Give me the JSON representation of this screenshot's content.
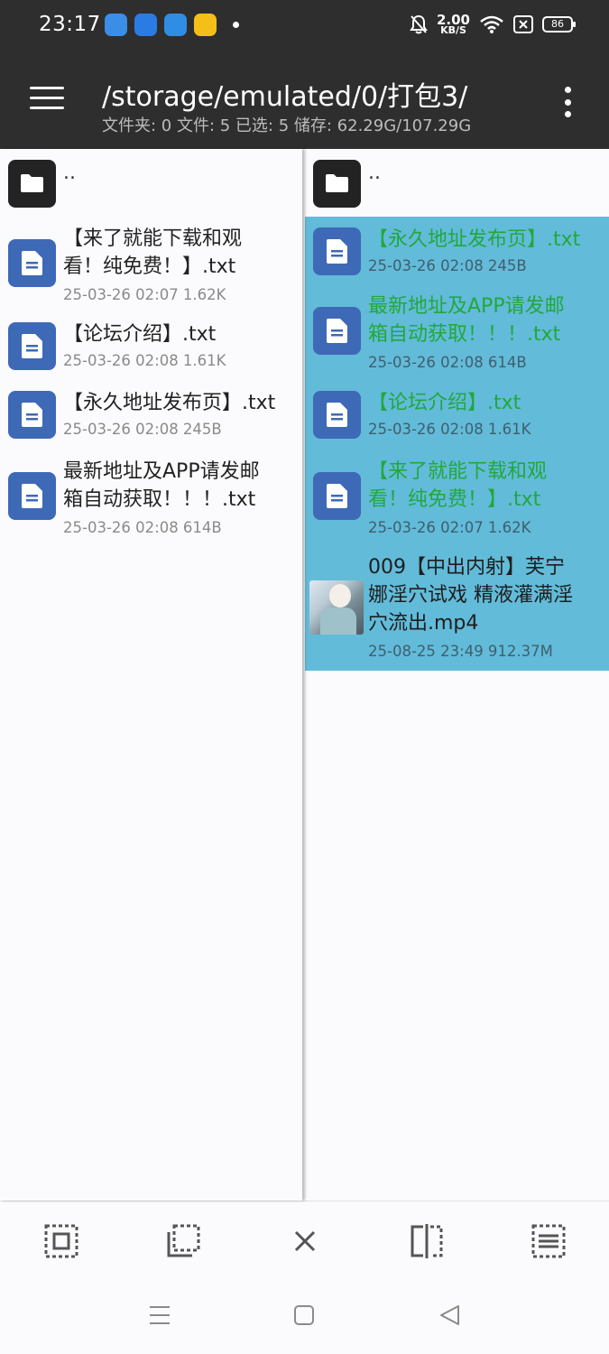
{
  "status_bar": {
    "time": "23:17",
    "net_speed_value": "2.00",
    "net_speed_unit": "KB/S",
    "battery": "86",
    "notification_icons": [
      "weather-icon",
      "messages-icon",
      "browser-icon",
      "shopping-app-icon"
    ],
    "system_icons": [
      "mute-icon",
      "wifi-icon",
      "sim-off-icon",
      "battery-icon"
    ]
  },
  "header": {
    "path": "/storage/emulated/0/打包3/",
    "info": "文件夹: 0  文件: 5  已选: 5  储存: 62.29G/107.29G"
  },
  "left_pane": {
    "parent_label": "..",
    "files": [
      {
        "name": "【来了就能下载和观看！纯免费！】.txt",
        "line1": "【来了就能下载和观",
        "line2": "看！纯免费！】.txt",
        "meta": "25-03-26 02:07  1.62K"
      },
      {
        "name": "【论坛介绍】.txt",
        "line1": "【论坛介绍】.txt",
        "meta": "25-03-26 02:08  1.61K"
      },
      {
        "name": "【永久地址发布页】.txt",
        "line1": "【永久地址发布页】.txt",
        "meta": "25-03-26 02:08  245B"
      },
      {
        "name": "最新地址及APP请发邮箱自动获取！！！.txt",
        "line1": "最新地址及APP请发邮",
        "line2": "箱自动获取！！！.txt",
        "meta": "25-03-26 02:08  614B"
      }
    ]
  },
  "right_pane": {
    "parent_label": "..",
    "files": [
      {
        "line1": "【永久地址发布页】.txt",
        "meta": "25-03-26 02:08  245B"
      },
      {
        "line1": "最新地址及APP请发邮",
        "line2": "箱自动获取！！！.txt",
        "meta": "25-03-26 02:08  614B"
      },
      {
        "line1": "【论坛介绍】.txt",
        "meta": "25-03-26 02:08  1.61K"
      },
      {
        "line1": "【来了就能下载和观",
        "line2": "看！纯免费！】.txt",
        "meta": "25-03-26 02:07  1.62K"
      },
      {
        "line1": "009【中出内射】芙宁",
        "line2": "娜淫穴试戏 精液灌满淫",
        "line3": "穴流出.mp4",
        "meta": "25-08-25 23:49  912.37M"
      }
    ],
    "selected_color": "#62bbd9",
    "selected_text_color": "#22a83b"
  },
  "toolbar": {
    "icons": [
      "select-all-icon",
      "copy-icon",
      "close-icon",
      "compare-icon",
      "select-list-icon"
    ]
  },
  "navbar": {
    "icons": [
      "recents-icon",
      "home-icon",
      "back-icon"
    ]
  }
}
